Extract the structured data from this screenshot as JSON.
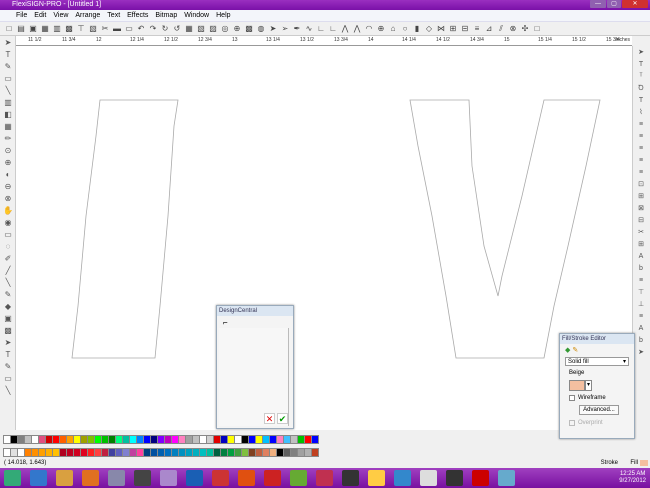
{
  "app": {
    "title": "FlexiSIGN-PRO - [Untitled 1]"
  },
  "window_buttons": [
    "minimize",
    "maximize",
    "close"
  ],
  "menu": [
    "File",
    "Edit",
    "View",
    "Arrange",
    "Text",
    "Effects",
    "Bitmap",
    "Window",
    "Help"
  ],
  "toolbar_icons": [
    "new-icon",
    "open-icon",
    "save-icon",
    "import-icon",
    "export-icon",
    "print-icon",
    "plot-icon",
    "cut-job-icon",
    "cut-icon",
    "copy-icon",
    "paste-icon",
    "undo-icon",
    "redo-icon",
    "redo2-icon",
    "undo2-icon",
    "layout-icon",
    "page-icon",
    "layer-icon",
    "color-icon",
    "zoom-icon",
    "palette-icon",
    "display-icon",
    "select-icon",
    "node-select-icon",
    "pen-icon",
    "curve-icon",
    "line-icon",
    "corner-icon",
    "angle-icon",
    "node-icon",
    "node2-icon",
    "arc-icon",
    "circle-icon",
    "shape-icon",
    "ellipse-icon",
    "rect-icon",
    "knife-icon",
    "weld-icon",
    "split-icon",
    "join-icon",
    "align-icon",
    "distort-icon",
    "mirror-icon",
    "contour-icon",
    "break-icon"
  ],
  "ruler": {
    "ticks": [
      "11 1/2",
      "11 3/4",
      "12",
      "12 1/4",
      "12 1/2",
      "12 3/4",
      "13",
      "13 1/4",
      "13 1/2",
      "13 3/4",
      "14",
      "14 1/4",
      "14 1/2",
      "14 3/4",
      "15",
      "15 1/4",
      "15 1/2",
      "15 3/4"
    ],
    "unit": "inches"
  },
  "design_central": {
    "title": "DesignCentral",
    "cancel": "✕",
    "ok": "✔"
  },
  "fill_stroke": {
    "title": "Fill/Stroke Editor",
    "fill_type": "Solid fill",
    "color_name": "Beige",
    "color": "#f4bfa0",
    "wireframe": "Wireframe",
    "wireframe_checked": false,
    "advanced": "Advanced...",
    "overprint": "Overprint",
    "overprint_checked": false
  },
  "palette1": [
    "#ffffff",
    "#000000",
    "#808080",
    "#c0c0c0",
    "#ffffff",
    "#e05080",
    "#d00000",
    "#ff0000",
    "#ff6000",
    "#ffa000",
    "#ffff00",
    "#a0a000",
    "#80c000",
    "#00ff00",
    "#00c000",
    "#008000",
    "#00ff80",
    "#00c0a0",
    "#00ffff",
    "#0080ff",
    "#0000ff",
    "#000080",
    "#8000ff",
    "#c000c0",
    "#ff00ff",
    "#ff80c0",
    "#a0a0a0",
    "#c0c0c0",
    "#ffffff",
    "#d0d0d0",
    "#e00000",
    "#0000c0",
    "#ffff00",
    "#ffffff",
    "#000000",
    "#0000ff",
    "#ffff00",
    "#00c0ff",
    "#0000ff",
    "#ff80c0",
    "#40c0ff",
    "#c0c0c0",
    "#00c000",
    "#ff0000",
    "#0000ff"
  ],
  "palette2": [
    "#ffffff",
    "#e0e0e0",
    "#ffffff",
    "#ff8000",
    "#ff9000",
    "#ffa000",
    "#ffb000",
    "#ffc000",
    "#b00020",
    "#c00020",
    "#d00020",
    "#e00020",
    "#ff2020",
    "#ff4040",
    "#c02040",
    "#4040a0",
    "#6060c0",
    "#8080d0",
    "#c040a0",
    "#ff40a0",
    "#004080",
    "#0050a0",
    "#0060b0",
    "#0070c0",
    "#0080c0",
    "#0090c0",
    "#00a0c0",
    "#00b0c0",
    "#00c0c0",
    "#00c0a0",
    "#006040",
    "#008040",
    "#00a040",
    "#40a040",
    "#80c040",
    "#804020",
    "#c06040",
    "#e08060",
    "#f0b080",
    "#000000",
    "#606060",
    "#808080",
    "#a0a0a0",
    "#b0b0b0",
    "#c04020"
  ],
  "status": {
    "coords": "( 14.018,   1.643)",
    "stroke_label": "Stroke",
    "fill_label": "Fill"
  },
  "taskbar": {
    "apps": [
      "start",
      "internet-explorer",
      "file-explorer",
      "media-player",
      "app",
      "usb",
      "flexisign",
      "photoshop",
      "bridge",
      "illustrator",
      "app2",
      "corel",
      "app3",
      "app4",
      "sticky-notes",
      "network",
      "solitaire",
      "calculator",
      "mcafee",
      "app5"
    ],
    "time": "12:25 AM",
    "date": "9/27/2012"
  }
}
